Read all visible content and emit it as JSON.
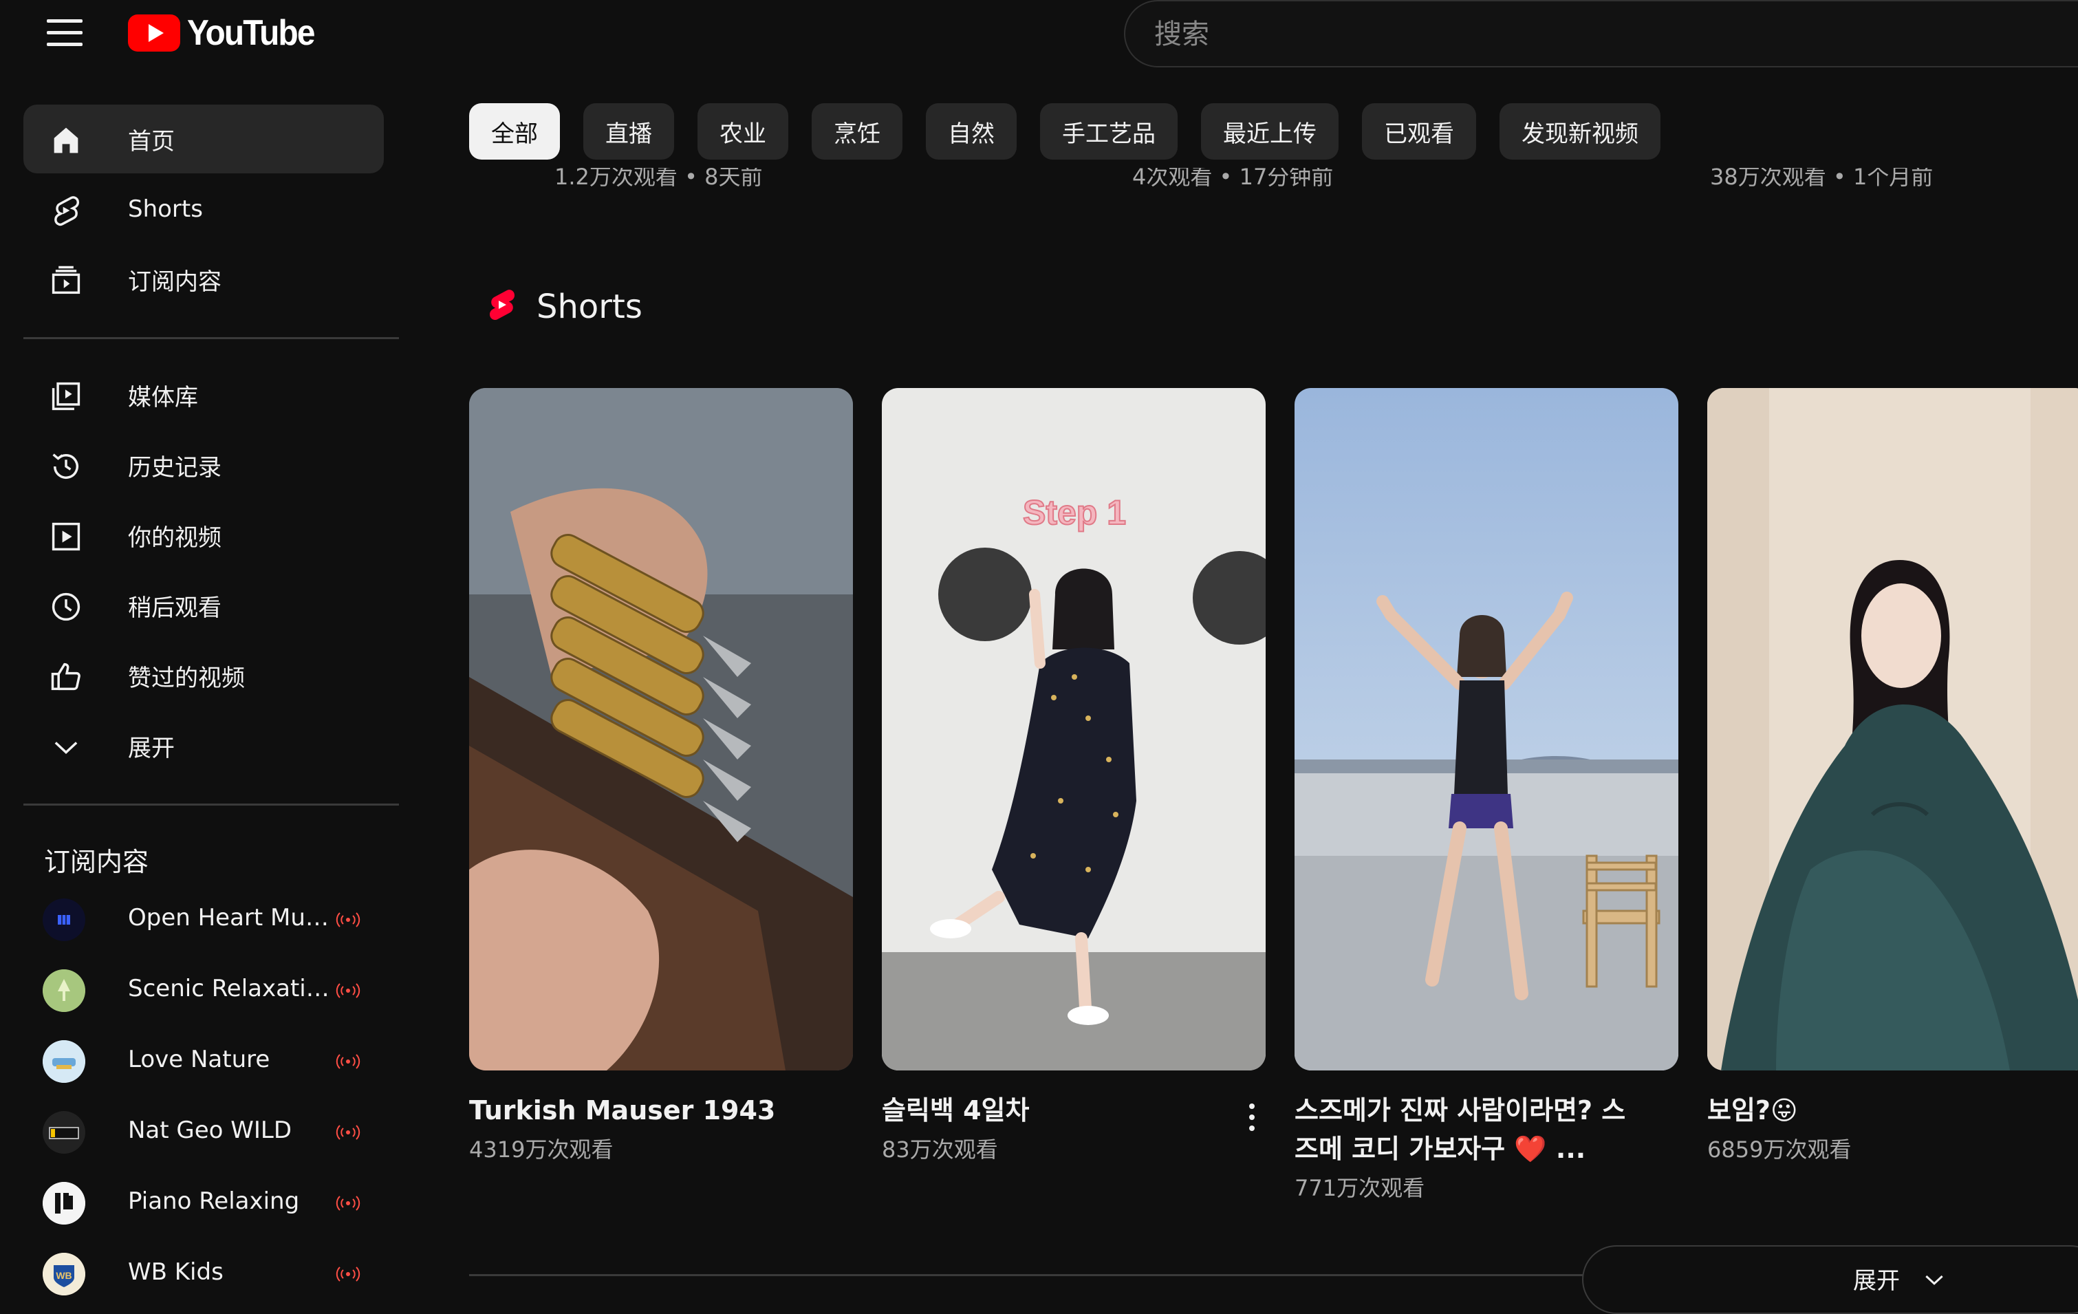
{
  "header": {
    "logo_text": "YouTube",
    "search_placeholder": "搜索"
  },
  "sidebar": {
    "main": [
      {
        "label": "首页",
        "icon": "home-icon",
        "active": true
      },
      {
        "label": "Shorts",
        "icon": "shorts-icon"
      },
      {
        "label": "订阅内容",
        "icon": "subscriptions-icon"
      }
    ],
    "you": [
      {
        "label": "媒体库",
        "icon": "library-icon"
      },
      {
        "label": "历史记录",
        "icon": "history-icon"
      },
      {
        "label": "你的视频",
        "icon": "your-videos-icon"
      },
      {
        "label": "稍后观看",
        "icon": "watch-later-icon"
      },
      {
        "label": "赞过的视频",
        "icon": "liked-icon"
      },
      {
        "label": "展开",
        "icon": "chevron-down-icon"
      }
    ],
    "subscriptions_title": "订阅内容",
    "subscriptions": [
      {
        "name": "Open Heart Musi...",
        "live": true
      },
      {
        "name": "Scenic Relaxation",
        "live": true
      },
      {
        "name": "Love Nature",
        "live": true
      },
      {
        "name": "Nat Geo WILD",
        "live": true
      },
      {
        "name": "Piano Relaxing",
        "live": true
      },
      {
        "name": "WB Kids",
        "live": true
      }
    ]
  },
  "chips": [
    "全部",
    "直播",
    "农业",
    "烹饪",
    "自然",
    "手工艺品",
    "最近上传",
    "已观看",
    "发现新视频"
  ],
  "previous_row_meta": [
    "1.2万次观看 • 8天前",
    "4次观看 • 17分钟前",
    "38万次观看 • 1个月前"
  ],
  "shorts": {
    "section_title": "Shorts",
    "items": [
      {
        "title": "Turkish Mauser 1943",
        "views": "4319万次观看"
      },
      {
        "title": "슬릭백 4일차",
        "views": "83万次观看",
        "overlay_text": "Step 1"
      },
      {
        "title": "스즈메가 진짜 사람이라면? 스즈메 코디 가보자구 ❤️ ...",
        "views": "771万次观看"
      },
      {
        "title": "보임?😛",
        "views": "6859万次观看"
      }
    ],
    "expand_label": "展开"
  },
  "colors": {
    "background": "#0f0f0f",
    "brand_red": "#ff0000",
    "chip_bg": "#272727",
    "text_secondary": "#aaaaaa"
  }
}
